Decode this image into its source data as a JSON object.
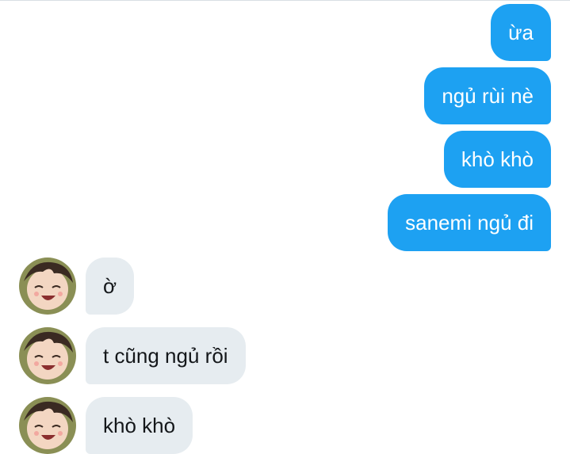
{
  "conversation": {
    "sent_messages": [
      {
        "text": "ừa"
      },
      {
        "text": "ngủ rùi nè"
      },
      {
        "text": "khò khò"
      },
      {
        "text": "sanemi ngủ đi"
      }
    ],
    "received_messages": [
      {
        "text": "ờ"
      },
      {
        "text": "t cũng ngủ rồi"
      },
      {
        "text": "khò khò"
      }
    ]
  },
  "colors": {
    "sent_bubble": "#1da1f2",
    "received_bubble": "#e6ecf0",
    "sent_text": "#ffffff",
    "received_text": "#14171a"
  },
  "icons": {
    "avatar": "cartoon-face-avatar"
  }
}
